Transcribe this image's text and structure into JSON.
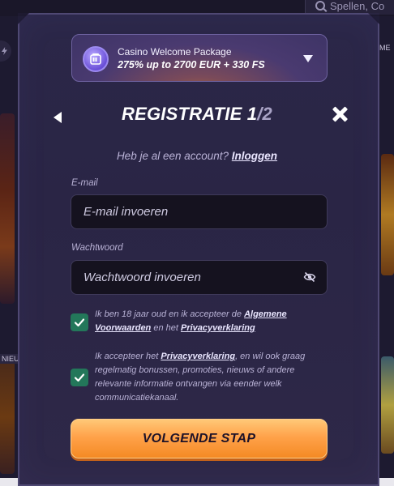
{
  "background": {
    "search_placeholder": "Spellen, Co",
    "side_badge_left": "NIEU",
    "side_badge_right": "ME"
  },
  "promo": {
    "title": "Casino Welcome Package",
    "subtitle": "275% up to 2700 EUR + 330 FS",
    "icon": "slot-machine-icon"
  },
  "header": {
    "title_main": "REGISTRATIE 1",
    "title_sep": "/",
    "title_total": "2",
    "back_icon": "back-arrow-icon",
    "close_icon": "close-icon"
  },
  "login": {
    "prompt": "Heb je al een account? ",
    "link": "Inloggen"
  },
  "form": {
    "email_label": "E-mail",
    "email_placeholder": "E-mail invoeren",
    "password_label": "Wachtwoord",
    "password_placeholder": "Wachtwoord invoeren"
  },
  "consents": {
    "age": {
      "checked": true,
      "text_before": "Ik ben 18 jaar oud en ik accepteer de ",
      "link1": "Algemene Voorwaarden",
      "text_mid": " en het ",
      "link2": "Privacyverklaring"
    },
    "marketing": {
      "checked": true,
      "text_before": "Ik accepteer het ",
      "link": "Privacyverklaring",
      "text_after": ", en wil ook graag regelmatig bonussen, promoties, nieuws of andere relevante informatie ontvangen via eender welk communicatiekanaal."
    }
  },
  "cta": {
    "label": "VOLGENDE STAP"
  },
  "colors": {
    "accent_orange": "#ffa24a",
    "check_green": "#23775a",
    "modal_bg": "#2b2748"
  }
}
